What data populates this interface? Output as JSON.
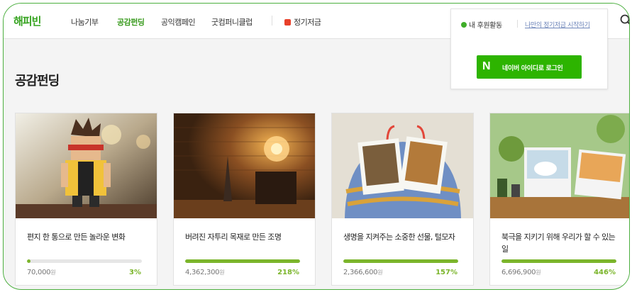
{
  "header": {
    "logo": "해피빈",
    "nav": [
      {
        "label": "나눔기부",
        "active": false
      },
      {
        "label": "공감펀딩",
        "active": true
      },
      {
        "label": "공익캠페인",
        "active": false
      },
      {
        "label": "굿컴퍼니클럽",
        "active": false
      }
    ],
    "pledge_label": "정기저금"
  },
  "dropdown": {
    "status_label": "내 후원활동",
    "start_link": "나만의 정기저금 시작하기",
    "naver_button_label": "네이버 아이디로 로그인"
  },
  "section": {
    "title": "공감펀딩"
  },
  "cards": [
    {
      "title": "편지 한 통으로 만든 놀라운 변화",
      "amount": "70,000",
      "unit": "원",
      "percent": "3%",
      "progress": 0.03
    },
    {
      "title": "버려진 자투리 목재로 만든 조명",
      "amount": "4,362,300",
      "unit": "원",
      "percent": "218%",
      "progress": 1.0
    },
    {
      "title": "생명을 지켜주는 소중한 선물, 털모자",
      "amount": "2,366,600",
      "unit": "원",
      "percent": "157%",
      "progress": 1.0
    },
    {
      "title": "북극을 지키기 위해 우리가 할 수 있는 일",
      "amount": "6,696,900",
      "unit": "원",
      "percent": "446%",
      "progress": 1.0
    }
  ],
  "colors": {
    "brand_green": "#35a31f",
    "progress_green": "#7bb52b",
    "naver_green": "#2db400"
  }
}
